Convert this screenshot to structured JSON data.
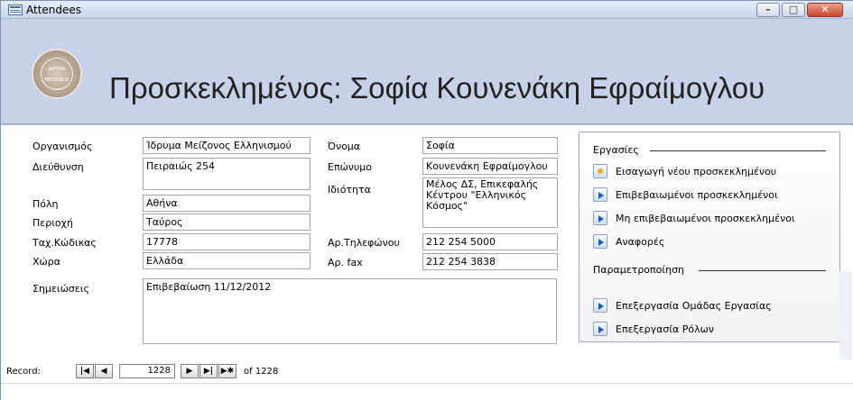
{
  "window": {
    "title": "Attendees"
  },
  "header": {
    "heading": "Προσκεκλημένος: Σοφία Κουνενάκη Εφραίμογλου",
    "logo_text": "ΙΔΡΥΜΑ ΜΕΙΖΟΝΟΣ ΕΛΛΗΝΙΣΜΟΥ"
  },
  "form": {
    "org_label": "Οργανισμός",
    "org_value": "Ίδρυμα Μείζονος Ελληνισμού",
    "address_label": "Διεύθυνση",
    "address_value": "Πειραιώς 254",
    "city_label": "Πόλη",
    "city_value": "Αθήνα",
    "region_label": "Περιοχή",
    "region_value": "Ταύρος",
    "zip_label": "Ταχ.Κώδικας",
    "zip_value": "17778",
    "country_label": "Χώρα",
    "country_value": "Ελλάδα",
    "notes_label": "Σημειώσεις",
    "notes_value": "Επιβεβαίωση 11/12/2012",
    "first_label": "Όνομα",
    "first_value": "Σοφία",
    "last_label": "Επώνυμο",
    "last_value": "Κουνενάκη Εφραίμογλου",
    "role_label": "Ιδιότητα",
    "role_value": "Μέλος ΔΣ, Επικεφαλής Κέντρου \"Ελληνικός Κόσμος\"",
    "phone_label": "Αρ.Τηλεφώνου",
    "phone_value": "212 254 5000",
    "fax_label": "Αρ. fax",
    "fax_value": "212 254 3838"
  },
  "panel": {
    "tasks_title": "Εργασίες",
    "tasks": [
      {
        "label": "Εισαγωγή νέου προσκεκλημένου",
        "icon": "new-record-icon"
      },
      {
        "label": "Επιβεβαιωμένοι προσκεκλημένοι",
        "icon": "arrow-right-icon"
      },
      {
        "label": "Μη επιβεβαιωμένοι προσκεκλημένοι",
        "icon": "arrow-right-icon"
      },
      {
        "label": "Αναφορές",
        "icon": "arrow-right-icon"
      }
    ],
    "settings_title": "Παραμετροποίηση",
    "settings": [
      {
        "label": "Επεξεργασία Ομάδας Εργασίας",
        "icon": "arrow-right-icon"
      },
      {
        "label": "Επεξεργασία Ρόλων",
        "icon": "arrow-right-icon"
      }
    ]
  },
  "recnav": {
    "record_label": "Record:",
    "current": "1228",
    "of_label": "of 1228"
  }
}
